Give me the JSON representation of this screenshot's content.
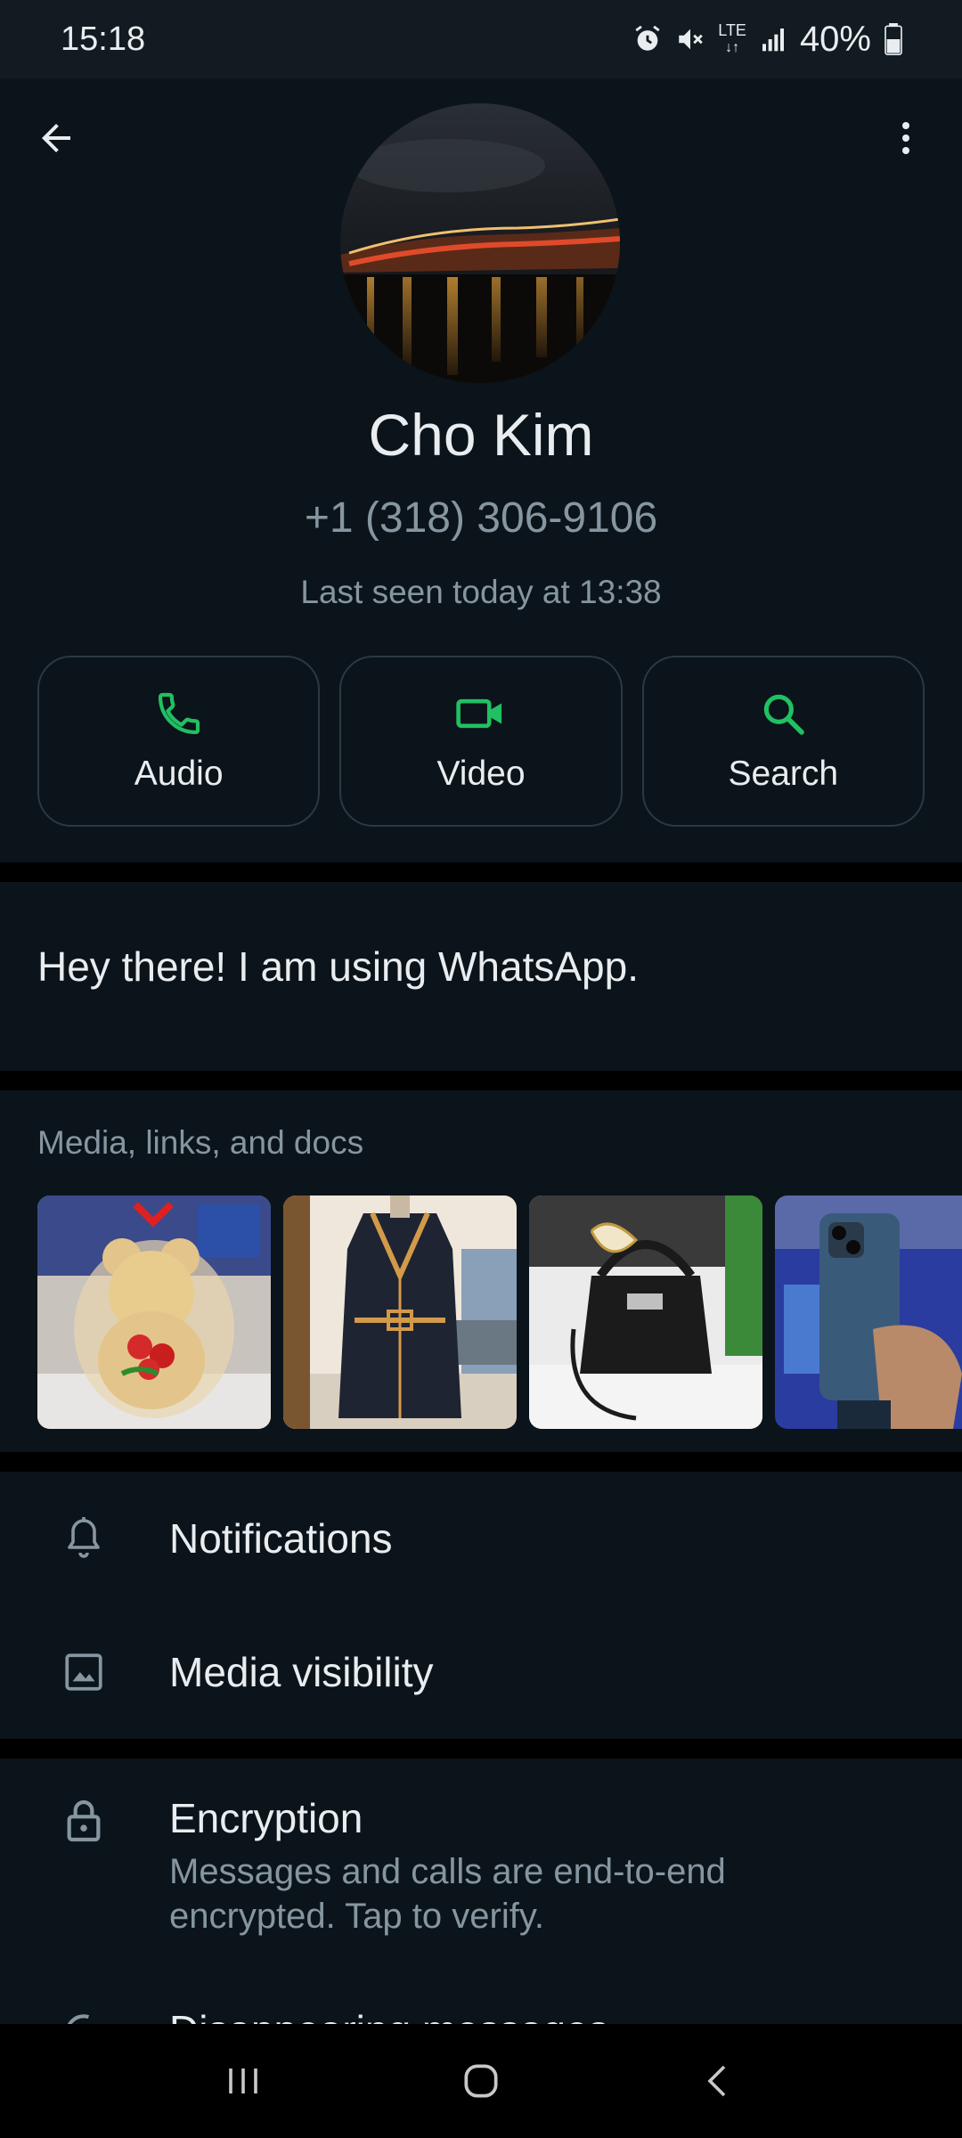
{
  "status_bar": {
    "time": "15:18",
    "battery": "40%",
    "icons": [
      "alarm-icon",
      "mute-icon",
      "lte-icon",
      "signal-icon",
      "battery-icon"
    ]
  },
  "header": {
    "back_icon": "arrow-left-icon",
    "menu_icon": "more-vert-icon"
  },
  "contact": {
    "name": "Cho Kim",
    "phone": "+1 (318) 306-9106",
    "last_seen": "Last seen today at 13:38"
  },
  "actions": [
    {
      "label": "Audio",
      "icon": "phone-icon"
    },
    {
      "label": "Video",
      "icon": "video-icon"
    },
    {
      "label": "Search",
      "icon": "search-icon"
    }
  ],
  "about": {
    "text": "Hey there! I am using WhatsApp."
  },
  "media": {
    "title": "Media, links, and docs",
    "items": [
      "teddy-bear-gift",
      "patterned-coat",
      "black-handbag",
      "blue-phone"
    ]
  },
  "settings": [
    {
      "label": "Notifications",
      "icon": "bell-icon"
    },
    {
      "label": "Media visibility",
      "icon": "image-icon"
    }
  ],
  "encryption": {
    "title": "Encryption",
    "description": "Messages and calls are end-to-end encrypted. Tap to verify.",
    "icon": "lock-icon"
  },
  "disappearing": {
    "label": "Disappearing messages",
    "icon": "timer-icon"
  },
  "nav": {
    "recents_icon": "recents-icon",
    "home_icon": "home-icon",
    "back_icon": "nav-back-icon"
  },
  "colors": {
    "accent": "#21c063",
    "background": "#0b141a",
    "secondary_text": "#8696a0"
  }
}
